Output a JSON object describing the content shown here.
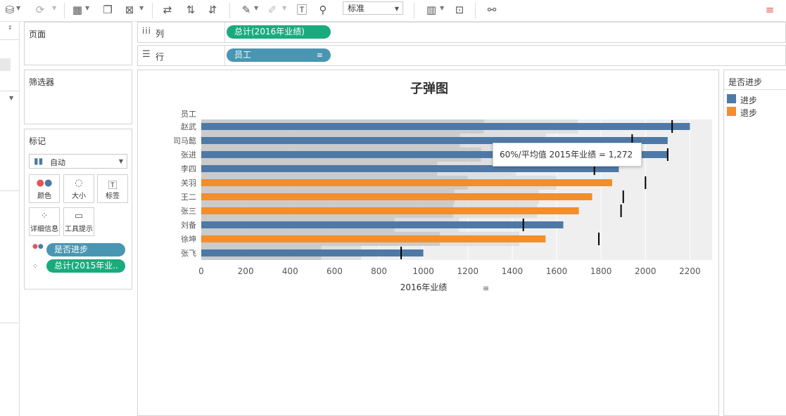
{
  "toolbar": {
    "style_select": "标准"
  },
  "panes": {
    "pages_title": "页面",
    "filters_title": "筛选器",
    "marks_title": "标记",
    "mark_type": "自动",
    "mark_buttons": [
      {
        "label": "颜色",
        "icon": "color-dots-icon"
      },
      {
        "label": "大小",
        "icon": "size-icon"
      },
      {
        "label": "标签",
        "icon": "label-icon"
      },
      {
        "label": "详细信息",
        "icon": "detail-dots-icon"
      },
      {
        "label": "工具提示",
        "icon": "tooltip-icon"
      }
    ],
    "mark_pills": [
      {
        "label": "是否进步",
        "color": "#4996b2"
      },
      {
        "label": "总计(2015年业..",
        "color": "#1aab7c"
      }
    ]
  },
  "shelves": {
    "columns_label": "列",
    "columns_pill": "总计(2016年业绩)",
    "rows_label": "行",
    "rows_pill": "员工"
  },
  "colors": {
    "progress": "#4e79a7",
    "regress": "#f28e2b",
    "green_pill": "#1aab7c",
    "blue_pill": "#4996b2"
  },
  "legend": {
    "title": "是否进步",
    "items": [
      {
        "label": "进步",
        "color": "#4e79a7"
      },
      {
        "label": "退步",
        "color": "#f28e2b"
      }
    ]
  },
  "tooltip": "60%/平均值 2015年业绩 = 1,272",
  "chart_data": {
    "type": "bar",
    "title": "子弹图",
    "row_header": "员工",
    "xlabel": "2016年业绩",
    "xlim": [
      0,
      2300
    ],
    "xticks": [
      0,
      200,
      400,
      600,
      800,
      1000,
      1200,
      1400,
      1600,
      1800,
      2000,
      2200
    ],
    "categories": [
      "赵武",
      "司马懿",
      "张进",
      "李四",
      "关羽",
      "王二",
      "张三",
      "刘备",
      "徐坤",
      "张飞"
    ],
    "values_2016": [
      2200,
      2100,
      2100,
      1880,
      1850,
      1760,
      1700,
      1630,
      1550,
      1000
    ],
    "values_2015": [
      2120,
      1940,
      2100,
      1770,
      2000,
      1900,
      1890,
      1450,
      1790,
      900
    ],
    "status": [
      "进步",
      "进步",
      "进步",
      "进步",
      "退步",
      "退步",
      "退步",
      "进步",
      "退步",
      "进步"
    ]
  }
}
